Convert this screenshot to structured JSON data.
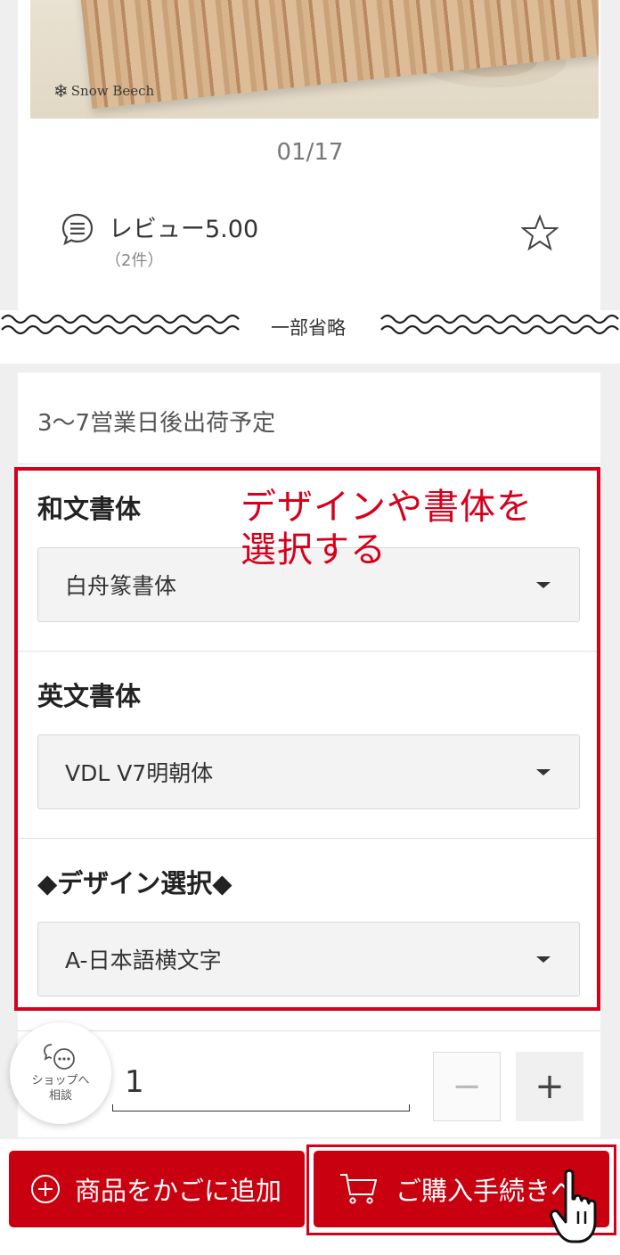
{
  "product": {
    "brand_logo": "Snow Beech",
    "image_counter": "01/17",
    "review_score": "レビュー5.00",
    "review_count": "（2件）"
  },
  "omission_label": "一部省略",
  "shipping": "3〜7営業日後出荷予定",
  "options": [
    {
      "label": "和文書体",
      "selected": "白舟篆書体"
    },
    {
      "label": "英文書体",
      "selected": "VDL V7明朝体"
    },
    {
      "label": "◆デザイン選択◆",
      "selected": "A-日本語横文字"
    }
  ],
  "annotation": {
    "line1": "デザインや書体を",
    "line2": "選択する"
  },
  "quantity": {
    "value": "1",
    "minus": "−",
    "plus": "+"
  },
  "chat": {
    "line1": "ショップへ",
    "line2": "相談"
  },
  "buttons": {
    "add_to_cart": "商品をかごに追加",
    "checkout": "ご購入手続きへ"
  },
  "colors": {
    "accent": "#c8000f",
    "highlight": "#d6001c"
  }
}
